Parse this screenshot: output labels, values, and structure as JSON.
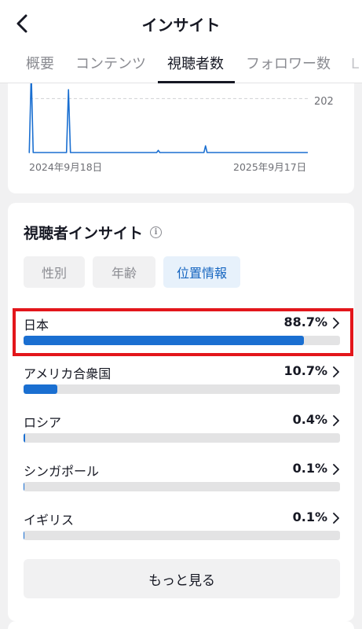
{
  "header": {
    "title": "インサイト"
  },
  "tabs": [
    {
      "label": "概要",
      "active": false
    },
    {
      "label": "コンテンツ",
      "active": false
    },
    {
      "label": "視聴者数",
      "active": true
    },
    {
      "label": "フォロワー数",
      "active": false
    },
    {
      "label": "L",
      "active": false
    }
  ],
  "chart": {
    "reference_value": "202",
    "start_label": "2024年9月18日",
    "end_label": "2025年9月17日",
    "line_color": "#1a6fd1"
  },
  "chart_data": {
    "type": "line",
    "x": [
      "2024年9月18日",
      "2025年9月17日"
    ],
    "reference_line": 202,
    "series": [
      {
        "values": [
          0,
          300,
          0,
          0,
          0,
          0,
          0,
          0,
          0,
          0,
          0,
          0,
          0,
          0,
          0,
          0,
          0,
          0,
          0,
          0,
          0,
          0,
          0,
          0,
          0,
          0,
          0,
          0,
          0,
          0,
          0,
          0,
          0,
          0,
          0,
          0,
          0,
          0,
          0,
          0,
          0,
          0,
          0,
          0,
          0,
          0,
          0,
          0,
          0,
          0,
          0,
          0,
          0,
          0,
          0,
          0,
          0,
          0,
          0,
          0,
          0,
          0,
          0,
          0,
          0,
          0,
          0,
          0,
          0,
          0,
          0,
          0,
          0,
          0,
          0,
          0,
          0,
          0,
          0,
          0,
          0,
          0,
          0,
          0,
          0,
          0,
          0,
          0,
          0,
          0,
          0,
          0,
          0,
          0,
          0,
          0,
          0,
          0,
          0,
          0
        ]
      }
    ],
    "peaks": [
      {
        "position": 0.005,
        "value": 300
      },
      {
        "position": 0.139,
        "value": 235
      },
      {
        "position": 0.462,
        "value": 8
      },
      {
        "position": 0.632,
        "value": 25
      }
    ],
    "ylim": [
      0,
      300
    ]
  },
  "insights": {
    "title": "視聴者インサイト",
    "filters": [
      {
        "label": "性別",
        "active": false
      },
      {
        "label": "年齢",
        "active": false
      },
      {
        "label": "位置情報",
        "active": true
      }
    ],
    "rows": [
      {
        "name": "日本",
        "percent": "88.7%",
        "value": 88.7
      },
      {
        "name": "アメリカ合衆国",
        "percent": "10.7%",
        "value": 10.7
      },
      {
        "name": "ロシア",
        "percent": "0.4%",
        "value": 0.4
      },
      {
        "name": "シンガポール",
        "percent": "0.1%",
        "value": 0.1
      },
      {
        "name": "イギリス",
        "percent": "0.1%",
        "value": 0.1
      }
    ],
    "more_label": "もっと見る"
  },
  "colors": {
    "accent": "#1a6fd1",
    "highlight": "#e3161b"
  }
}
